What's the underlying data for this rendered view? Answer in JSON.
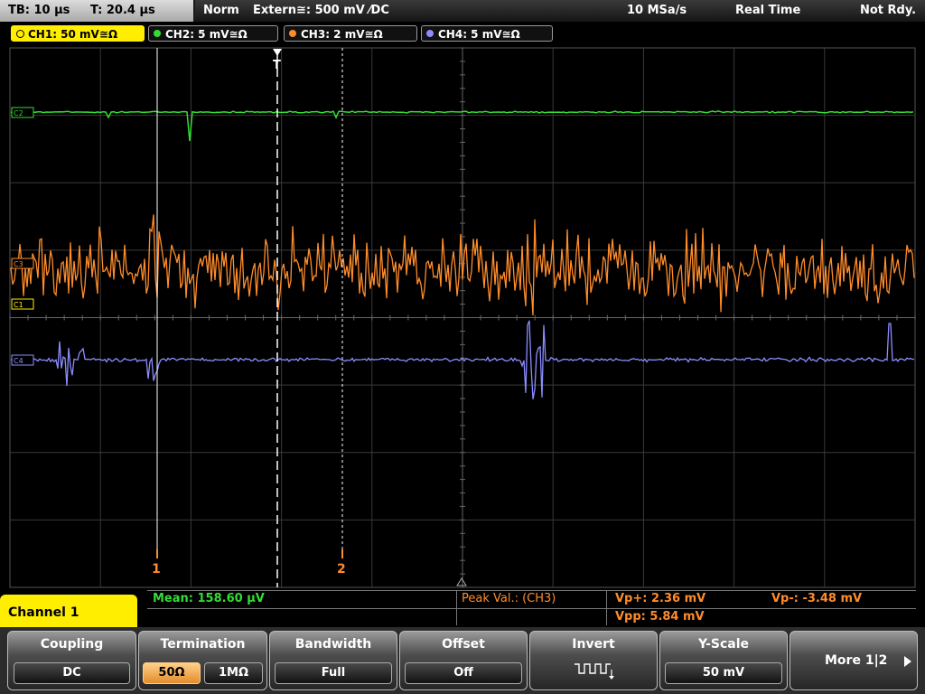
{
  "top_bar": {
    "timebase": "TB: 10 µs",
    "trigger_time": "T: 20.4 µs",
    "trigger_mode": "Norm",
    "trigger_source": "Extern≅: 500 mV ⁄DC",
    "sample_rate": "10 MSa/s",
    "acquisition": "Real Time",
    "status": "Not Rdy."
  },
  "channels": [
    {
      "label": "CH1: 50 mV≅Ω",
      "color": "#ffee00",
      "active": true
    },
    {
      "label": "CH2: 5 mV≅Ω",
      "color": "#33dd33",
      "active": false
    },
    {
      "label": "CH3: 2 mV≅Ω",
      "color": "#ff8c2a",
      "active": false
    },
    {
      "label": "CH4: 5 mV≅Ω",
      "color": "#8c8cff",
      "active": false
    }
  ],
  "trace_markers": {
    "ch2": "C2",
    "ch3": "C3",
    "ch1": "C1",
    "ch4": "C4",
    "trigger": "T"
  },
  "cursors": {
    "cursor1": "1",
    "cursor2": "2"
  },
  "measurements": {
    "mean": "Mean: 158.60 µV",
    "peak_title": "Peak Val.:  (CH3)",
    "vp_plus": "Vp+: 2.36 mV",
    "vp_minus": "Vp-: -3.48 mV",
    "vpp": "Vpp: 5.84 mV"
  },
  "menu_title": "Channel 1",
  "softkeys": {
    "coupling": {
      "title": "Coupling",
      "value": "DC"
    },
    "termination": {
      "title": "Termination",
      "option1": "50Ω",
      "option2": "1MΩ"
    },
    "bandwidth": {
      "title": "Bandwidth",
      "value": "Full"
    },
    "offset": {
      "title": "Offset",
      "value": "Off"
    },
    "invert": {
      "title": "Invert",
      "icon": "inverted-square-wave-icon"
    },
    "yscale": {
      "title": "Y-Scale",
      "value": "50 mV"
    },
    "more": {
      "label": "More 1|2",
      "icon": "triangle-right-icon"
    }
  }
}
